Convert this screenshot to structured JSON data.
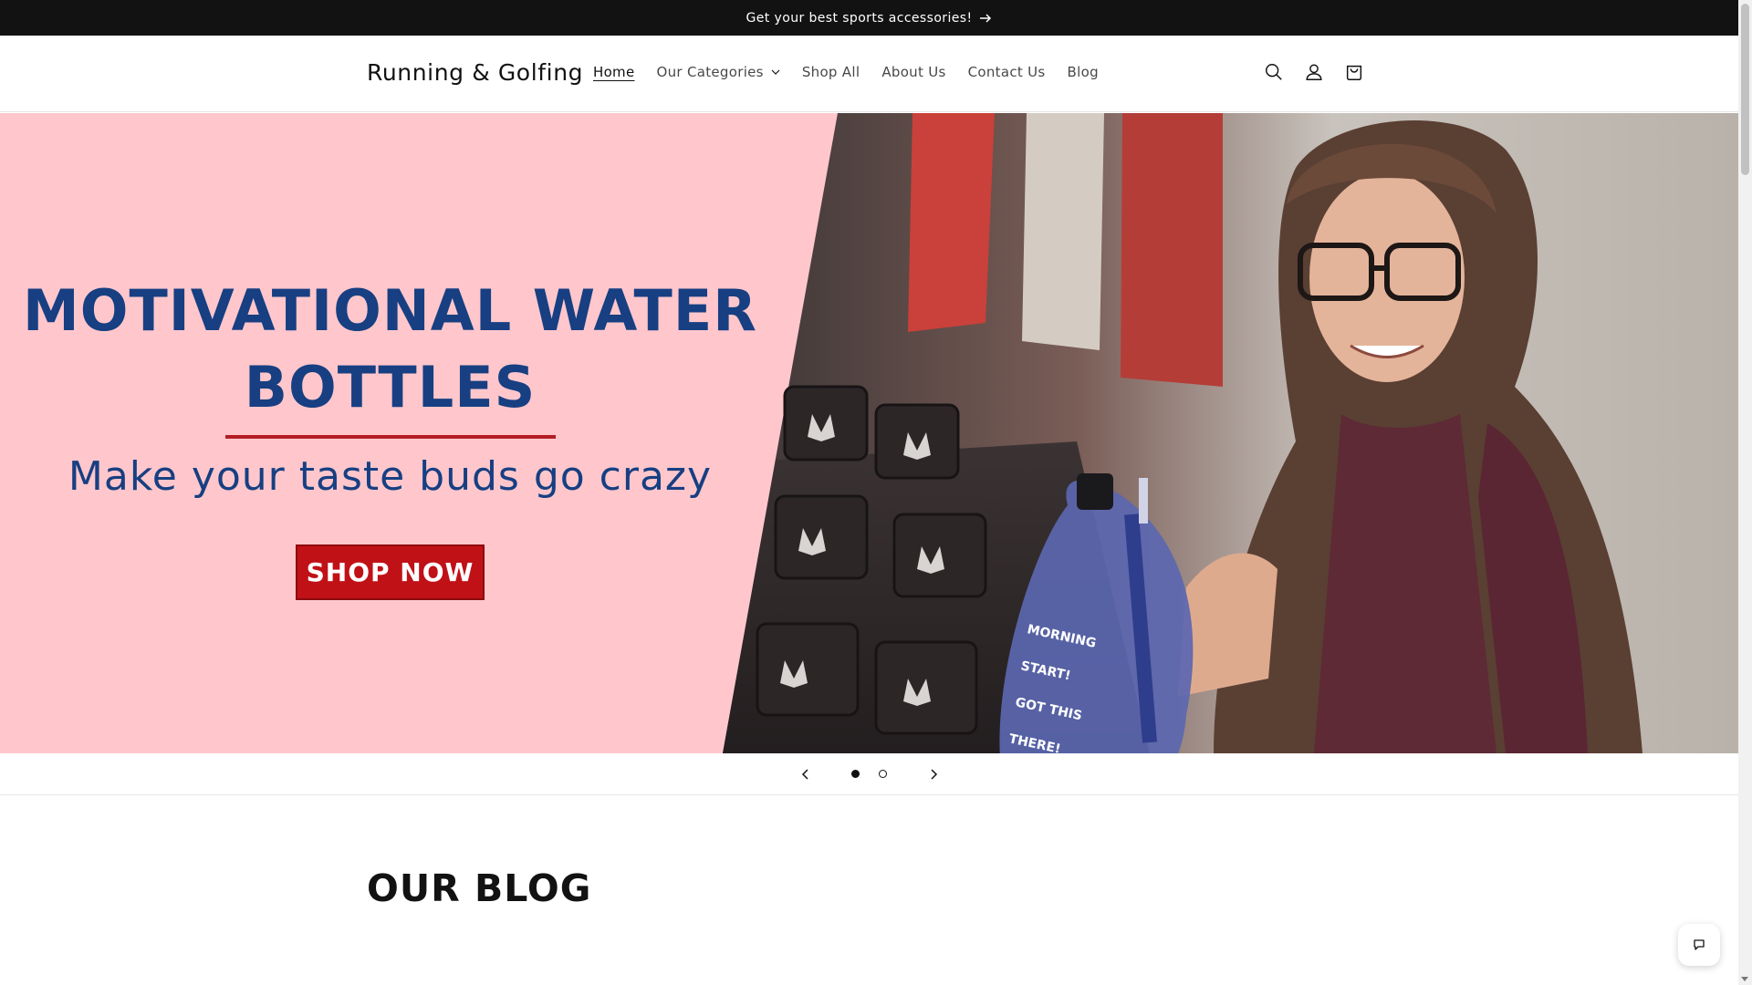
{
  "announcement": {
    "text": "Get your best sports accessories!",
    "icon": "arrow-right-icon"
  },
  "header": {
    "logo": "Running & Golfing",
    "nav": [
      {
        "label": "Home",
        "active": true
      },
      {
        "label": "Our Categories",
        "dropdown": true
      },
      {
        "label": "Shop All"
      },
      {
        "label": "About Us"
      },
      {
        "label": "Contact Us"
      },
      {
        "label": "Blog"
      }
    ],
    "icons": [
      "search-icon",
      "account-icon",
      "cart-icon"
    ]
  },
  "hero": {
    "heading_line1": "MOTIVATIONAL WATER",
    "heading_line2": "BOTTLES",
    "subheading": "Make your taste buds go crazy",
    "cta": "SHOP NOW",
    "colors": {
      "background": "#ffc7cc",
      "heading": "#173f82",
      "rule": "#b31d24",
      "button": "#c01117"
    }
  },
  "slider": {
    "total": 2,
    "current": 1,
    "prev_icon": "chevron-left-icon",
    "next_icon": "chevron-right-icon"
  },
  "blog": {
    "title": "OUR BLOG"
  },
  "chat": {
    "icon": "chat-icon"
  }
}
